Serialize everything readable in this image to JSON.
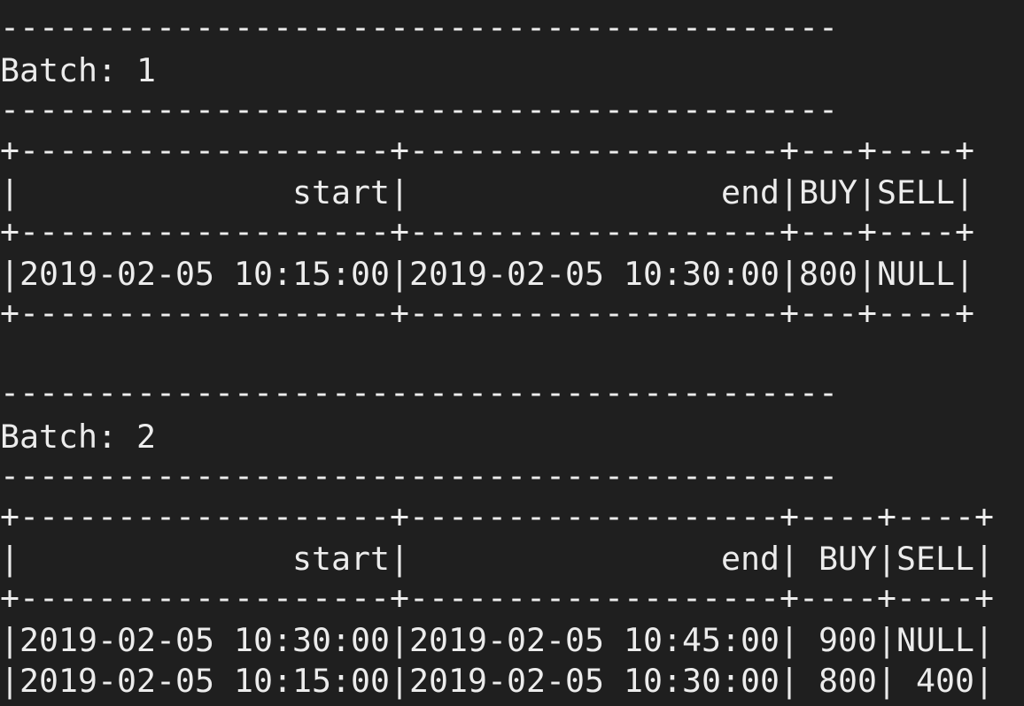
{
  "terminal": {
    "lines": [
      "-------------------------------------------",
      "Batch: 1",
      "-------------------------------------------",
      "+-------------------+-------------------+---+----+",
      "|              start|                end|BUY|SELL|",
      "+-------------------+-------------------+---+----+",
      "|2019-02-05 10:15:00|2019-02-05 10:30:00|800|NULL|",
      "+-------------------+-------------------+---+----+",
      "",
      "-------------------------------------------",
      "Batch: 2",
      "-------------------------------------------",
      "+-------------------+-------------------+----+----+",
      "|              start|                end| BUY|SELL|",
      "+-------------------+-------------------+----+----+",
      "|2019-02-05 10:30:00|2019-02-05 10:45:00| 900|NULL|",
      "|2019-02-05 10:15:00|2019-02-05 10:30:00| 800| 400|"
    ]
  }
}
